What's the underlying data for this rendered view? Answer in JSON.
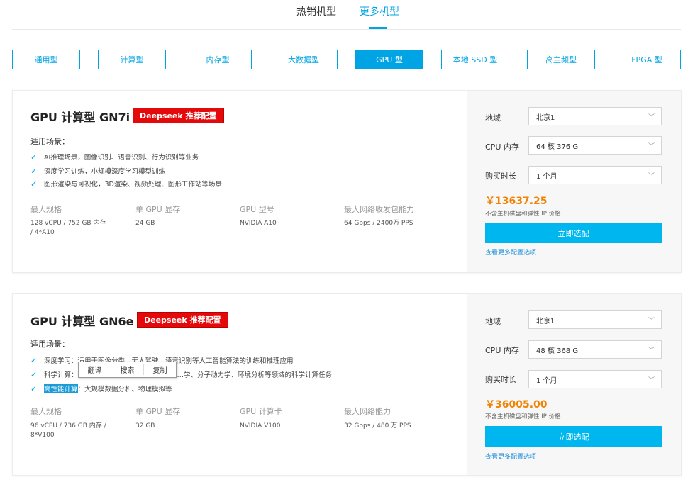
{
  "top_tabs": [
    {
      "label": "热销机型",
      "active": false
    },
    {
      "label": "更多机型",
      "active": true
    }
  ],
  "filters": [
    {
      "label": "通用型"
    },
    {
      "label": "计算型"
    },
    {
      "label": "内存型"
    },
    {
      "label": "大数据型"
    },
    {
      "label": "GPU 型"
    },
    {
      "label": "本地 SSD 型"
    },
    {
      "label": "高主频型"
    },
    {
      "label": "FPGA 型"
    }
  ],
  "cards": [
    {
      "title": "GPU 计算型 GN7i",
      "badge": "Deepseek 推荐配置",
      "scene_title": "适用场景：",
      "bullets": [
        "AI推理场景，图像识别、语音识别、行为识别等业务",
        "深度学习训练，小规模深度学习模型训练",
        "图形渲染与可视化，3D渲染、视频处理、图形工作站等场景"
      ],
      "specs": [
        {
          "label": "最大规格",
          "value": "128 vCPU / 752 GB 内存\n/ 4*A10"
        },
        {
          "label": "单 GPU 显存",
          "value": "24 GB"
        },
        {
          "label": "GPU 型号",
          "value": "NVIDIA A10"
        },
        {
          "label": "最大网络收发包能力",
          "value": "64 Gbps / 2400万 PPS"
        }
      ],
      "config": {
        "region_label": "地域",
        "region_value": "北京1",
        "cpu_label": "CPU 内存",
        "cpu_value": "64 核 376 G",
        "duration_label": "购买时长",
        "duration_value": "1 个月",
        "price": "￥13637.25",
        "price_note": "不含主机磁盘和弹性 IP 价格",
        "buy_label": "立即选配",
        "more_link": "查看更多配置选项"
      }
    },
    {
      "title": "GPU 计算型 GN6e",
      "badge": "Deepseek 推荐配置",
      "scene_title": "适用场景：",
      "bullets": [
        {
          "pre": "深度学习：适用于图像分类、无人驾驶、语音识别等人工智能算法的训练和推理应用",
          "hl": "",
          "post": ""
        },
        {
          "pre": "科学计算：",
          "hl": "",
          "post": "…学、分子动力学、环境分析等领域的科学计算任务"
        },
        {
          "pre": "",
          "hl": "高性能计算",
          "post": "：大规模数据分析、物理模拟等"
        }
      ],
      "specs": [
        {
          "label": "最大规格",
          "value": "96 vCPU / 736 GB 内存 /\n8*V100"
        },
        {
          "label": "单 GPU 显存",
          "value": "32 GB"
        },
        {
          "label": "GPU 计算卡",
          "value": "NVIDIA V100"
        },
        {
          "label": "最大网络能力",
          "value": "32 Gbps / 480 万 PPS"
        }
      ],
      "config": {
        "region_label": "地域",
        "region_value": "北京1",
        "cpu_label": "CPU 内存",
        "cpu_value": "48 核 368 G",
        "duration_label": "购买时长",
        "duration_value": "1 个月",
        "price": "￥36005.00",
        "price_note": "不含主机磁盘和弹性 IP 价格",
        "buy_label": "立即选配",
        "more_link": "查看更多配置选项"
      }
    }
  ],
  "context_menu": {
    "items": [
      "翻译",
      "搜索",
      "复制"
    ]
  },
  "colors": {
    "accent": "#00a4e4",
    "badge": "#e4090a",
    "price": "#f08300",
    "buy_button": "#00b6ee"
  },
  "icons": {
    "bullet": "check-icon",
    "select": "chevron-down-icon"
  }
}
